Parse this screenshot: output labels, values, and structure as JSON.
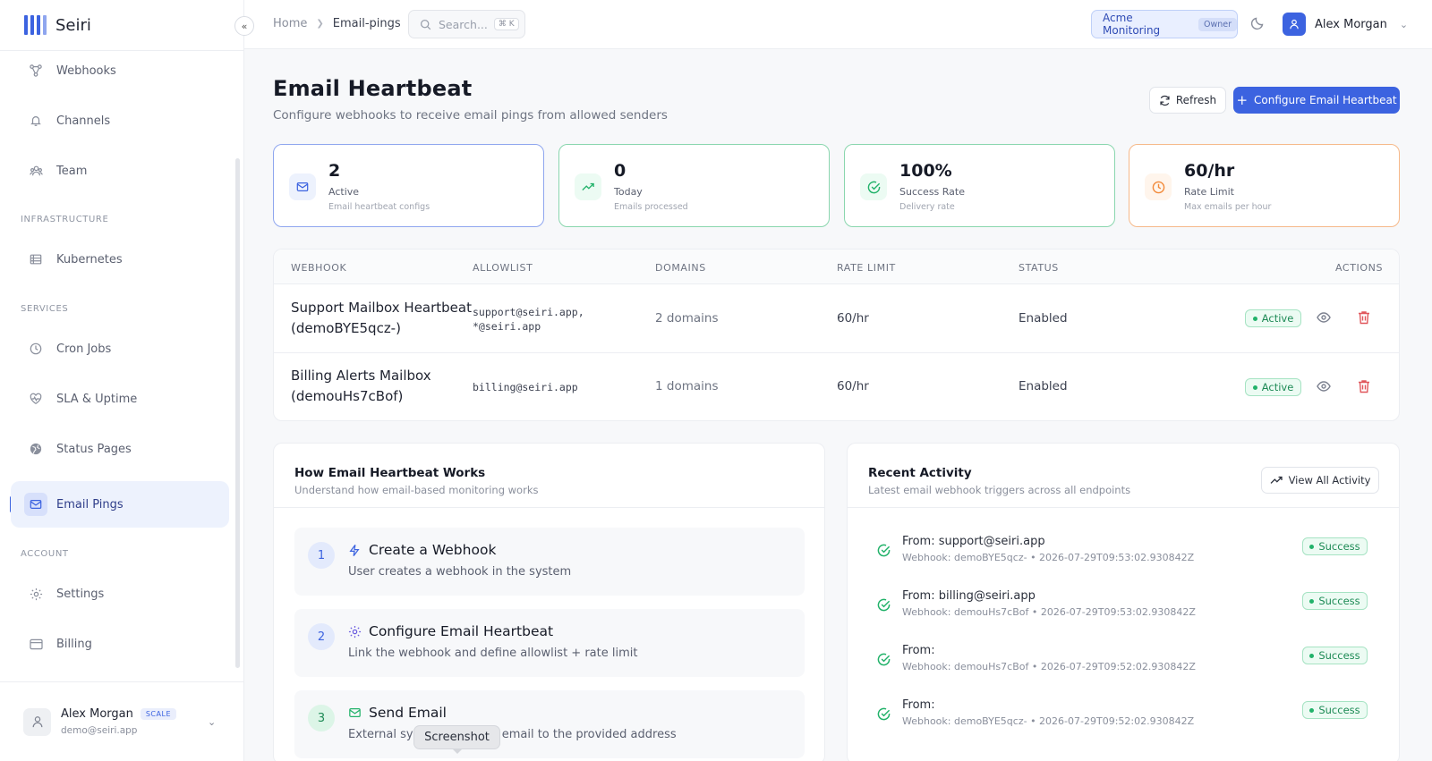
{
  "app": {
    "name": "Seiri"
  },
  "sidebar": {
    "items": [
      {
        "label": "Webhooks",
        "icon": "webhook-icon"
      },
      {
        "label": "Channels",
        "icon": "bell-icon"
      },
      {
        "label": "Team",
        "icon": "team-icon"
      },
      {
        "label": "Kubernetes",
        "icon": "server-icon"
      },
      {
        "label": "Cron Jobs",
        "icon": "clock-icon"
      },
      {
        "label": "SLA & Uptime",
        "icon": "heart-pulse-icon"
      },
      {
        "label": "Status Pages",
        "icon": "globe-icon"
      },
      {
        "label": "Email Pings",
        "icon": "mail-icon",
        "active": true
      },
      {
        "label": "Settings",
        "icon": "gear-icon"
      },
      {
        "label": "Billing",
        "icon": "card-icon"
      }
    ],
    "sections": {
      "infrastructure": "INFRASTRUCTURE",
      "services": "SERVICES",
      "account": "ACCOUNT"
    },
    "user": {
      "name": "Alex Morgan",
      "plan": "SCALE",
      "email": "demo@seiri.app"
    }
  },
  "topbar": {
    "breadcrumb": {
      "home": "Home",
      "current": "Email-pings"
    },
    "search": {
      "placeholder": "Search...",
      "shortcut": "⌘ K"
    },
    "org": {
      "name": "Acme Monitoring",
      "role": "Owner"
    },
    "user": {
      "name": "Alex Morgan"
    }
  },
  "page": {
    "title": "Email Heartbeat",
    "subtitle": "Configure webhooks to receive email pings from allowed senders",
    "refresh_label": "Refresh",
    "configure_label": "Configure Email Heartbeat"
  },
  "stats": [
    {
      "value": "2",
      "label": "Active",
      "sub": "Email heartbeat configs",
      "color": "#3c63e0"
    },
    {
      "value": "0",
      "label": "Today",
      "sub": "Emails processed",
      "color": "#22b26a"
    },
    {
      "value": "100%",
      "label": "Success Rate",
      "sub": "Delivery rate",
      "color": "#22b26a"
    },
    {
      "value": "60/hr",
      "label": "Rate Limit",
      "sub": "Max emails per hour",
      "color": "#f28a3a"
    }
  ],
  "table": {
    "headers": {
      "webhook": "WEBHOOK",
      "allowlist": "ALLOWLIST",
      "domains": "DOMAINS",
      "rate": "RATE LIMIT",
      "status": "STATUS",
      "actions": "ACTIONS"
    },
    "rows": [
      {
        "name1": "Support Mailbox Heartbeat",
        "name2": "(demoBYE5qcz-)",
        "allow1": "support@seiri.app,",
        "allow2": "*@seiri.app",
        "domains": "2 domains",
        "rate": "60/hr",
        "status": "Enabled",
        "badge": "Active"
      },
      {
        "name1": "Billing Alerts Mailbox",
        "name2": "(demouHs7cBof)",
        "allow1": "billing@seiri.app",
        "allow2": "",
        "domains": "1 domains",
        "rate": "60/hr",
        "status": "Enabled",
        "badge": "Active"
      }
    ]
  },
  "how": {
    "title": "How Email Heartbeat Works",
    "subtitle": "Understand how email-based monitoring works",
    "steps": [
      {
        "num": "1",
        "title": "Create a Webhook",
        "desc": "User creates a webhook in the system"
      },
      {
        "num": "2",
        "title": "Configure Email Heartbeat",
        "desc": "Link the webhook and define allowlist + rate limit"
      },
      {
        "num": "3",
        "title": "Send Email",
        "desc": "External system sends an email to the provided address"
      }
    ]
  },
  "activity": {
    "title": "Recent Activity",
    "subtitle": "Latest email webhook triggers across all endpoints",
    "view_all": "View All Activity",
    "items": [
      {
        "from": "From: support@seiri.app",
        "meta": "Webhook: demoBYE5qcz- • 2026-07-29T09:53:02.930842Z",
        "status": "Success"
      },
      {
        "from": "From: billing@seiri.app",
        "meta": "Webhook: demouHs7cBof • 2026-07-29T09:53:02.930842Z",
        "status": "Success"
      },
      {
        "from": "From:",
        "meta": "Webhook: demouHs7cBof • 2026-07-29T09:52:02.930842Z",
        "status": "Success"
      },
      {
        "from": "From:",
        "meta": "Webhook: demoBYE5qcz- • 2026-07-29T09:52:02.930842Z",
        "status": "Success"
      }
    ]
  },
  "tooltip": "Screenshot"
}
